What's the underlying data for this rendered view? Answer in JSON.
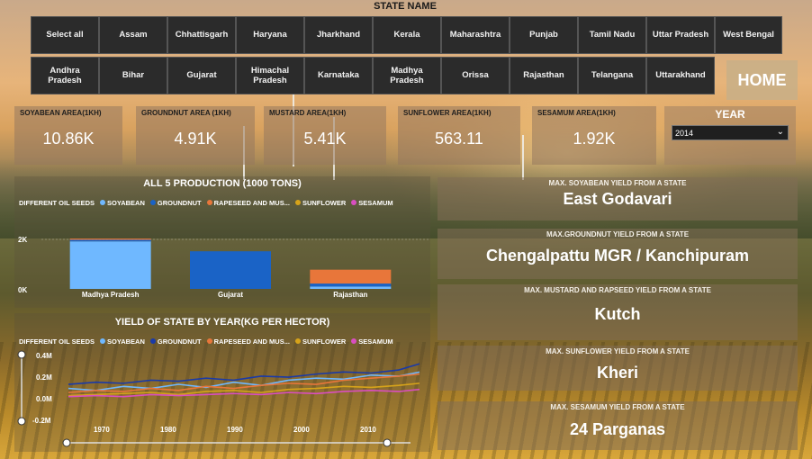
{
  "page": {
    "home_label": "HOME",
    "state_slicer_title": "STATE NAME"
  },
  "states_row1": [
    "Select all",
    "Assam",
    "Chhattisgarh",
    "Haryana",
    "Jharkhand",
    "Kerala",
    "Maharashtra",
    "Punjab",
    "Tamil Nadu",
    "Uttar Pradesh",
    "West Bengal"
  ],
  "states_row2": [
    "Andhra Pradesh",
    "Bihar",
    "Gujarat",
    "Himachal Pradesh",
    "Karnataka",
    "Madhya Pradesh",
    "Orissa",
    "Rajasthan",
    "Telangana",
    "Uttarakhand"
  ],
  "kpis": [
    {
      "label": "SOYABEAN AREA(1KH)",
      "value": "10.86K"
    },
    {
      "label": "GROUNDNUT AREA (1KH)",
      "value": "4.91K"
    },
    {
      "label": "MUSTARD AREA(1KH)",
      "value": "5.41K"
    },
    {
      "label": "SUNFLOWER AREA(1KH)",
      "value": "563.11"
    },
    {
      "label": "SESAMUM AREA(1KH)",
      "value": "1.92K"
    }
  ],
  "year_filter": {
    "label": "YEAR",
    "selected": "2014"
  },
  "colors": {
    "soyabean": "#6fb8ff",
    "groundnut": "#1a63c6",
    "rapeseed": "#e8763a",
    "sunflower": "#d6a31a",
    "sesamum": "#d94ec0"
  },
  "production_chart": {
    "title": "ALL 5 PRODUCTION (1000 TONS)",
    "legend_title": "DIFFERENT OIL SEEDS",
    "legend": [
      "SOYABEAN",
      "GROUNDNUT",
      "RAPESEED AND MUS...",
      "SUNFLOWER",
      "SESAMUM"
    ],
    "yticks": [
      "2K",
      "0K"
    ]
  },
  "yield_chart": {
    "title": "YIELD OF STATE BY YEAR(KG PER HECTOR)",
    "legend_title": "DIFFERENT OIL SEEDS",
    "legend": [
      "SOYABEAN",
      "GROUNDNUT",
      "RAPESEED AND MUS...",
      "SUNFLOWER",
      "SESAMUM"
    ],
    "yticks": [
      "0.4M",
      "0.2M",
      "0.0M",
      "-0.2M"
    ],
    "xticks": [
      "1970",
      "1980",
      "1990",
      "2000",
      "2010"
    ]
  },
  "chart_data": [
    {
      "type": "bar",
      "title": "ALL 5 PRODUCTION (1000 TONS)",
      "categories": [
        "Madhya Pradesh",
        "Gujarat",
        "Rajasthan"
      ],
      "ylim": [
        0,
        2500
      ],
      "series": [
        {
          "name": "SOYABEAN",
          "values": [
            2400,
            0,
            120
          ]
        },
        {
          "name": "GROUNDNUT",
          "values": [
            80,
            1900,
            150
          ]
        },
        {
          "name": "RAPESEED AND MUS...",
          "values": [
            60,
            0,
            700
          ]
        },
        {
          "name": "SUNFLOWER",
          "values": [
            0,
            0,
            0
          ]
        },
        {
          "name": "SESAMUM",
          "values": [
            0,
            0,
            0
          ]
        }
      ]
    },
    {
      "type": "line",
      "title": "YIELD OF STATE BY YEAR(KG PER HECTOR)",
      "xlim": [
        1966,
        2017
      ],
      "ylim": [
        -0.2,
        0.45
      ],
      "x": [
        1966,
        1970,
        1974,
        1978,
        1982,
        1986,
        1990,
        1994,
        1998,
        2002,
        2006,
        2010,
        2014,
        2017
      ],
      "series": [
        {
          "name": "GROUNDNUT",
          "values": [
            0.16,
            0.18,
            0.17,
            0.2,
            0.19,
            0.22,
            0.2,
            0.24,
            0.23,
            0.26,
            0.28,
            0.27,
            0.3,
            0.36
          ]
        },
        {
          "name": "SOYABEAN",
          "values": [
            0.12,
            0.1,
            0.14,
            0.12,
            0.16,
            0.13,
            0.18,
            0.15,
            0.2,
            0.22,
            0.21,
            0.25,
            0.24,
            0.28
          ]
        },
        {
          "name": "RAPESEED AND MUS...",
          "values": [
            0.08,
            0.1,
            0.09,
            0.12,
            0.1,
            0.14,
            0.12,
            0.15,
            0.17,
            0.16,
            0.2,
            0.22,
            0.24,
            0.26
          ]
        },
        {
          "name": "SUNFLOWER",
          "values": [
            0.05,
            0.06,
            0.07,
            0.08,
            0.06,
            0.09,
            0.1,
            0.08,
            0.11,
            0.12,
            0.14,
            0.13,
            0.15,
            0.17
          ]
        },
        {
          "name": "SESAMUM",
          "values": [
            0.04,
            0.05,
            0.04,
            0.06,
            0.05,
            0.06,
            0.07,
            0.06,
            0.08,
            0.07,
            0.09,
            0.1,
            0.09,
            0.11
          ]
        }
      ]
    }
  ],
  "insights": [
    {
      "label": "MAX. SOYABEAN YIELD FROM A STATE",
      "value": "East Godavari"
    },
    {
      "label": "MAX.GROUNDNUT YIELD FROM A STATE",
      "value": "Chengalpattu MGR / Kanchipuram"
    },
    {
      "label": "MAX. MUSTARD AND RAPSEED YIELD FROM A STATE",
      "value": "Kutch"
    },
    {
      "label": "MAX. SUNFLOWER YIELD FROM A STATE",
      "value": "Kheri"
    },
    {
      "label": "MAX. SESAMUM YIELD FROM A STATE",
      "value": "24 Parganas"
    }
  ]
}
